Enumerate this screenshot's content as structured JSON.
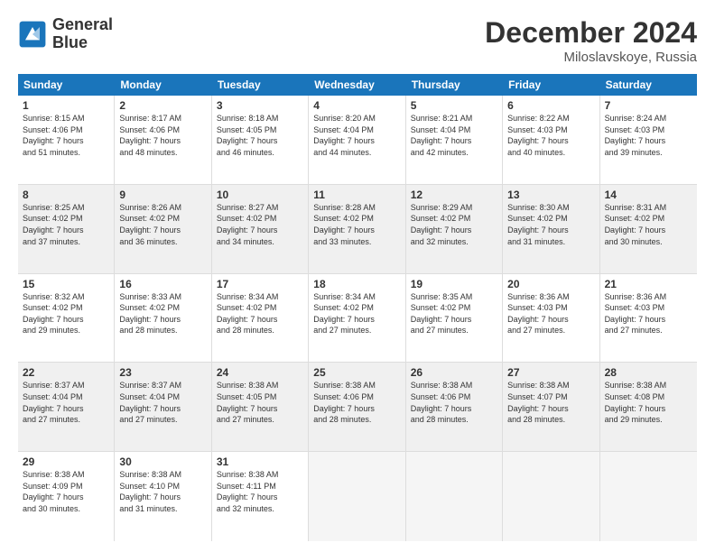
{
  "logo": {
    "line1": "General",
    "line2": "Blue"
  },
  "title": "December 2024",
  "location": "Miloslavskoye, Russia",
  "header_days": [
    "Sunday",
    "Monday",
    "Tuesday",
    "Wednesday",
    "Thursday",
    "Friday",
    "Saturday"
  ],
  "weeks": [
    [
      {
        "day": "1",
        "info": "Sunrise: 8:15 AM\nSunset: 4:06 PM\nDaylight: 7 hours\nand 51 minutes.",
        "shaded": false
      },
      {
        "day": "2",
        "info": "Sunrise: 8:17 AM\nSunset: 4:06 PM\nDaylight: 7 hours\nand 48 minutes.",
        "shaded": false
      },
      {
        "day": "3",
        "info": "Sunrise: 8:18 AM\nSunset: 4:05 PM\nDaylight: 7 hours\nand 46 minutes.",
        "shaded": false
      },
      {
        "day": "4",
        "info": "Sunrise: 8:20 AM\nSunset: 4:04 PM\nDaylight: 7 hours\nand 44 minutes.",
        "shaded": false
      },
      {
        "day": "5",
        "info": "Sunrise: 8:21 AM\nSunset: 4:04 PM\nDaylight: 7 hours\nand 42 minutes.",
        "shaded": false
      },
      {
        "day": "6",
        "info": "Sunrise: 8:22 AM\nSunset: 4:03 PM\nDaylight: 7 hours\nand 40 minutes.",
        "shaded": false
      },
      {
        "day": "7",
        "info": "Sunrise: 8:24 AM\nSunset: 4:03 PM\nDaylight: 7 hours\nand 39 minutes.",
        "shaded": false
      }
    ],
    [
      {
        "day": "8",
        "info": "Sunrise: 8:25 AM\nSunset: 4:02 PM\nDaylight: 7 hours\nand 37 minutes.",
        "shaded": true
      },
      {
        "day": "9",
        "info": "Sunrise: 8:26 AM\nSunset: 4:02 PM\nDaylight: 7 hours\nand 36 minutes.",
        "shaded": true
      },
      {
        "day": "10",
        "info": "Sunrise: 8:27 AM\nSunset: 4:02 PM\nDaylight: 7 hours\nand 34 minutes.",
        "shaded": true
      },
      {
        "day": "11",
        "info": "Sunrise: 8:28 AM\nSunset: 4:02 PM\nDaylight: 7 hours\nand 33 minutes.",
        "shaded": true
      },
      {
        "day": "12",
        "info": "Sunrise: 8:29 AM\nSunset: 4:02 PM\nDaylight: 7 hours\nand 32 minutes.",
        "shaded": true
      },
      {
        "day": "13",
        "info": "Sunrise: 8:30 AM\nSunset: 4:02 PM\nDaylight: 7 hours\nand 31 minutes.",
        "shaded": true
      },
      {
        "day": "14",
        "info": "Sunrise: 8:31 AM\nSunset: 4:02 PM\nDaylight: 7 hours\nand 30 minutes.",
        "shaded": true
      }
    ],
    [
      {
        "day": "15",
        "info": "Sunrise: 8:32 AM\nSunset: 4:02 PM\nDaylight: 7 hours\nand 29 minutes.",
        "shaded": false
      },
      {
        "day": "16",
        "info": "Sunrise: 8:33 AM\nSunset: 4:02 PM\nDaylight: 7 hours\nand 28 minutes.",
        "shaded": false
      },
      {
        "day": "17",
        "info": "Sunrise: 8:34 AM\nSunset: 4:02 PM\nDaylight: 7 hours\nand 28 minutes.",
        "shaded": false
      },
      {
        "day": "18",
        "info": "Sunrise: 8:34 AM\nSunset: 4:02 PM\nDaylight: 7 hours\nand 27 minutes.",
        "shaded": false
      },
      {
        "day": "19",
        "info": "Sunrise: 8:35 AM\nSunset: 4:02 PM\nDaylight: 7 hours\nand 27 minutes.",
        "shaded": false
      },
      {
        "day": "20",
        "info": "Sunrise: 8:36 AM\nSunset: 4:03 PM\nDaylight: 7 hours\nand 27 minutes.",
        "shaded": false
      },
      {
        "day": "21",
        "info": "Sunrise: 8:36 AM\nSunset: 4:03 PM\nDaylight: 7 hours\nand 27 minutes.",
        "shaded": false
      }
    ],
    [
      {
        "day": "22",
        "info": "Sunrise: 8:37 AM\nSunset: 4:04 PM\nDaylight: 7 hours\nand 27 minutes.",
        "shaded": true
      },
      {
        "day": "23",
        "info": "Sunrise: 8:37 AM\nSunset: 4:04 PM\nDaylight: 7 hours\nand 27 minutes.",
        "shaded": true
      },
      {
        "day": "24",
        "info": "Sunrise: 8:38 AM\nSunset: 4:05 PM\nDaylight: 7 hours\nand 27 minutes.",
        "shaded": true
      },
      {
        "day": "25",
        "info": "Sunrise: 8:38 AM\nSunset: 4:06 PM\nDaylight: 7 hours\nand 28 minutes.",
        "shaded": true
      },
      {
        "day": "26",
        "info": "Sunrise: 8:38 AM\nSunset: 4:06 PM\nDaylight: 7 hours\nand 28 minutes.",
        "shaded": true
      },
      {
        "day": "27",
        "info": "Sunrise: 8:38 AM\nSunset: 4:07 PM\nDaylight: 7 hours\nand 28 minutes.",
        "shaded": true
      },
      {
        "day": "28",
        "info": "Sunrise: 8:38 AM\nSunset: 4:08 PM\nDaylight: 7 hours\nand 29 minutes.",
        "shaded": true
      }
    ],
    [
      {
        "day": "29",
        "info": "Sunrise: 8:38 AM\nSunset: 4:09 PM\nDaylight: 7 hours\nand 30 minutes.",
        "shaded": false
      },
      {
        "day": "30",
        "info": "Sunrise: 8:38 AM\nSunset: 4:10 PM\nDaylight: 7 hours\nand 31 minutes.",
        "shaded": false
      },
      {
        "day": "31",
        "info": "Sunrise: 8:38 AM\nSunset: 4:11 PM\nDaylight: 7 hours\nand 32 minutes.",
        "shaded": false
      },
      {
        "day": "",
        "info": "",
        "shaded": false,
        "empty": true
      },
      {
        "day": "",
        "info": "",
        "shaded": false,
        "empty": true
      },
      {
        "day": "",
        "info": "",
        "shaded": false,
        "empty": true
      },
      {
        "day": "",
        "info": "",
        "shaded": false,
        "empty": true
      }
    ]
  ]
}
